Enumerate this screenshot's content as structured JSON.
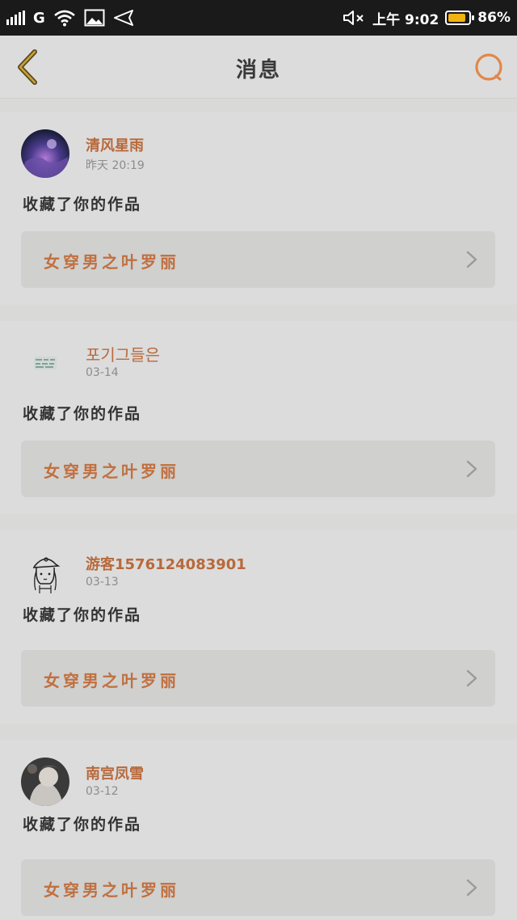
{
  "status_bar": {
    "network": "G",
    "time": "上午 9:02",
    "battery": "86%",
    "battery_level": 0.86
  },
  "header": {
    "title": "消息"
  },
  "messages": [
    {
      "user": "清风星雨",
      "time": "昨天 20:19",
      "action": "收藏了你的作品",
      "work": "女穿男之叶罗丽"
    },
    {
      "user": "포기그들은",
      "time": "03-14",
      "action": "收藏了你的作品",
      "work": "女穿男之叶罗丽"
    },
    {
      "user": "游客1576124083901",
      "time": "03-13",
      "action": "收藏了你的作品",
      "work": "女穿男之叶罗丽"
    },
    {
      "user": "南宫凤雪",
      "time": "03-12",
      "action": "收藏了你的作品",
      "work": "女穿男之叶罗丽"
    }
  ],
  "colors": {
    "accent": "#b8693b",
    "link_text": "#c07040",
    "search_icon": "#e0884a",
    "back_icon": "#5a4a20"
  }
}
